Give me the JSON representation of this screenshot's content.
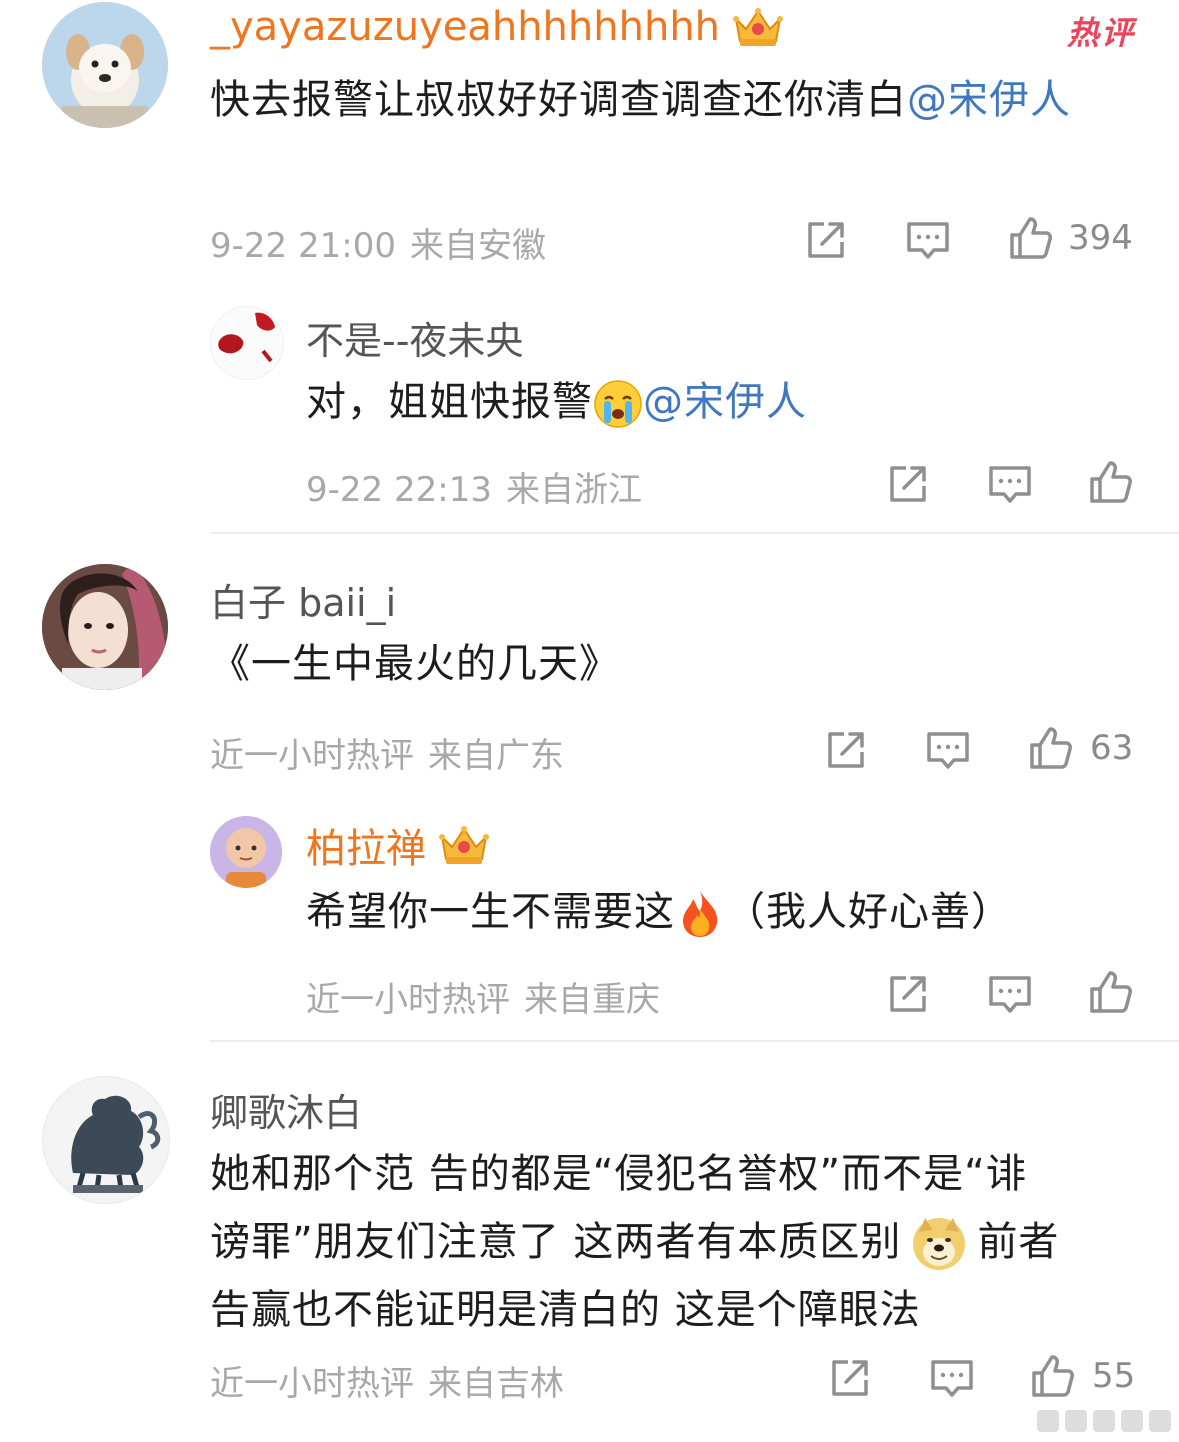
{
  "comments": [
    {
      "user": "_yayazuzuyeahhhhhhhhh",
      "hot_label": "热评",
      "text": "快去报警让叔叔好好调查调查还你清白",
      "mention": "@宋伊人",
      "time": "9-22 21:00",
      "location": "来自安徽",
      "likes": "394",
      "reply": {
        "user": "不是--夜未央",
        "text": "对，姐姐快报警",
        "mention": "@宋伊人",
        "time": "9-22 22:13",
        "location": "来自浙江"
      }
    },
    {
      "user": "白子 baii_i",
      "text": "《一生中最火的几天》",
      "time": "近一小时热评",
      "location": "来自广东",
      "likes": "63",
      "reply": {
        "user": "柏拉禅",
        "text_a": "希望你一生不需要这",
        "text_b": "（我人好心善）",
        "time": "近一小时热评",
        "location": "来自重庆"
      }
    },
    {
      "user": "卿歌沐白",
      "line1": "她和那个范 告的都是“侵犯名誉权”而不是“诽",
      "line2a": "谤罪”朋友们注意了 这两者有本质区别",
      "line2b": "前者",
      "line3": "告赢也不能证明是清白的 这是个障眼法",
      "time": "近一小时热评",
      "location": "来自吉林",
      "likes": "55"
    }
  ],
  "colors": {
    "vip_name": "#f0751c",
    "mention": "#3f78bf",
    "hot": "#e9465b",
    "meta": "#a8a8a8"
  },
  "icons": [
    "share-icon",
    "comment-icon",
    "like-icon",
    "crown-icon",
    "crying-emoji",
    "fire-emoji",
    "doge-emoji"
  ]
}
